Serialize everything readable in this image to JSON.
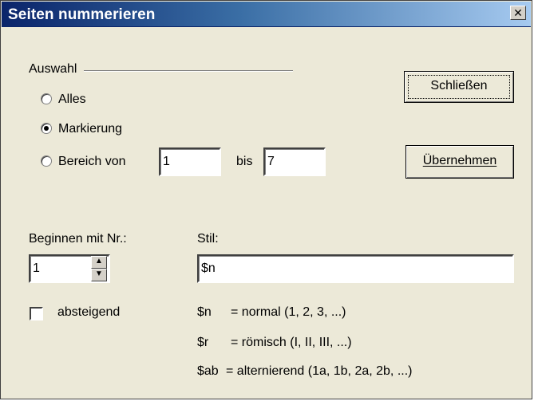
{
  "window": {
    "title": "Seiten nummerieren",
    "close_glyph": "✕"
  },
  "auswahl": {
    "group_label": "Auswahl",
    "options": [
      {
        "label": "Alles",
        "selected": false
      },
      {
        "label": "Markierung",
        "selected": true
      },
      {
        "label": "Bereich von",
        "selected": false
      }
    ],
    "range_from": "1",
    "bis_label": "bis",
    "range_to": "7"
  },
  "buttons": {
    "close": "Schließen",
    "apply": "Übernehmen"
  },
  "start": {
    "label": "Beginnen mit Nr.:",
    "value": "1"
  },
  "style": {
    "label": "Stil:",
    "value": "$n"
  },
  "descending": {
    "label": "absteigend",
    "checked": false
  },
  "legend": [
    {
      "code": "$n",
      "desc": "= normal (1, 2, 3, ...)"
    },
    {
      "code": "$r",
      "desc": "= römisch (I, II, III, ...)"
    },
    {
      "code": "$ab",
      "desc": "= alternierend (1a, 1b, 2a, 2b, ...)"
    }
  ]
}
